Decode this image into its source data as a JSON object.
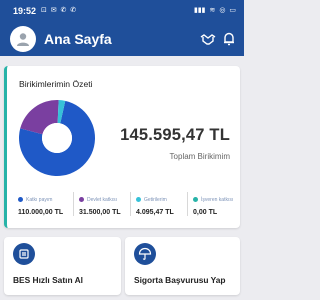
{
  "status_bar": {
    "time": "19:52",
    "left_icons": "⊡ ✉ ✆ ✆",
    "right_icons": [
      "▮▮▮",
      "≋",
      "◎",
      "▭"
    ]
  },
  "header": {
    "title": "Ana Sayfa",
    "icons": [
      "avatar-user-icon",
      "handshake-icon",
      "bell-icon"
    ]
  },
  "summary": {
    "title": "Birikimlerimin Özeti",
    "total": "145.595,47 TL",
    "total_label": "Toplam Birikimim",
    "colors": {
      "accent": "#27b3a8",
      "brand": "#1f4f9a",
      "purple": "#7a3fa0",
      "cyan": "#36c1d8"
    },
    "donut_segments": [
      {
        "name": "Katkı payım",
        "value": 110000.0,
        "color": "#1f59c7"
      },
      {
        "name": "Devlet katkısı",
        "value": 31500.0,
        "color": "#7a3fa0"
      },
      {
        "name": "Getirilerim",
        "value": 4095.47,
        "color": "#36c1d8"
      },
      {
        "name": "İşveren katkısı",
        "value": 0.0,
        "color": "#27b3a8"
      }
    ],
    "legend": [
      {
        "label": "Katkı payım",
        "value": "110.000,00 TL",
        "color": "#1f59c7"
      },
      {
        "label": "Devlet katkısı",
        "value": "31.500,00 TL",
        "color": "#7a3fa0"
      },
      {
        "label": "Getirilerim",
        "value": "4.095,47 TL",
        "color": "#36c1d8"
      },
      {
        "label": "İşveren katkısı",
        "value": "0,00 TL",
        "color": "#27b3a8"
      }
    ]
  },
  "actions": [
    {
      "label": "BES Hızlı Satın Al",
      "icon": "bes-card-icon"
    },
    {
      "label": "Sigorta Başvurusu Yap",
      "icon": "umbrella-icon"
    }
  ]
}
